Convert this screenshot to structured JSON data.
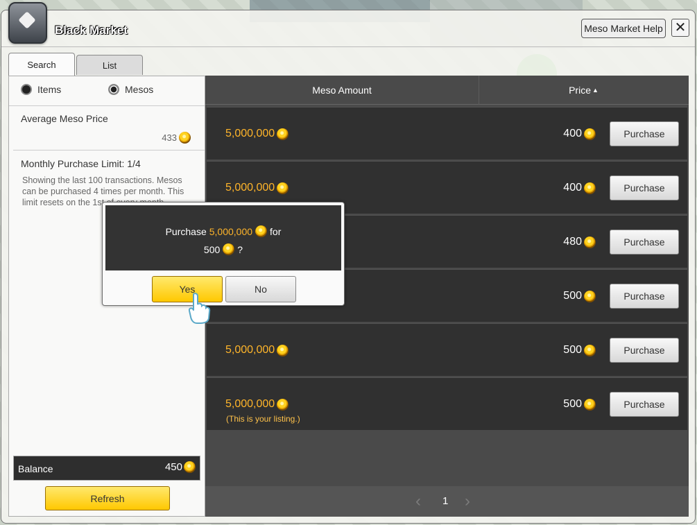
{
  "window": {
    "title": "Black Market",
    "help_label": "Meso Market Help",
    "close_icon": "close-icon"
  },
  "tabs": [
    {
      "label": "Search",
      "active": true
    },
    {
      "label": "List",
      "active": false
    }
  ],
  "left": {
    "radio_items": "Items",
    "radio_mesos": "Mesos",
    "selected": "Mesos",
    "avg_label": "Average Meso Price",
    "avg_value": "433",
    "limit_label": "Monthly Purchase Limit: 1/4",
    "description": "Showing the last 100 transactions. Mesos can be purchased 4 times per month. This limit resets on the 1st of every month.",
    "balance_label": "Balance",
    "balance_value": "450",
    "refresh_label": "Refresh"
  },
  "table": {
    "col_amount": "Meso Amount",
    "col_price": "Price",
    "sort_icon": "sort-up-icon",
    "buy_label": "Purchase",
    "rows": [
      {
        "amount": "5,000,000",
        "price": "400",
        "note": ""
      },
      {
        "amount": "5,000,000",
        "price": "400",
        "note": ""
      },
      {
        "amount": "",
        "price": "480",
        "note": ""
      },
      {
        "amount": "",
        "price": "500",
        "note": ""
      },
      {
        "amount": "5,000,000",
        "price": "500",
        "note": ""
      },
      {
        "amount": "5,000,000",
        "price": "500",
        "note": "(This is your listing.)"
      }
    ]
  },
  "pagination": {
    "page": "1"
  },
  "dialog": {
    "prefix": "Purchase",
    "amount": "5,000,000",
    "middle": "for",
    "price": "500",
    "suffix": "?",
    "yes": "Yes",
    "no": "No"
  },
  "colors": {
    "accent_yellow": "#ffc800",
    "meso_orange": "#ffb52a",
    "dark_row": "#303030"
  }
}
